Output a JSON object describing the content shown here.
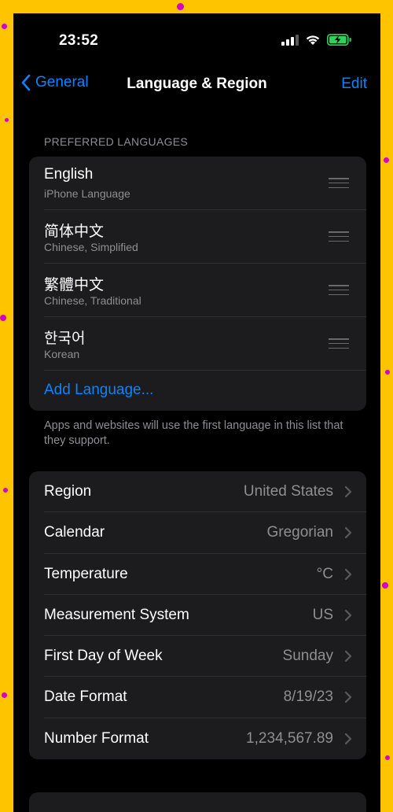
{
  "status": {
    "time": "23:52"
  },
  "nav": {
    "back_label": "General",
    "title": "Language & Region",
    "edit_label": "Edit"
  },
  "preferred": {
    "header": "PREFERRED LANGUAGES",
    "languages": [
      {
        "name": "English",
        "sub": "iPhone Language"
      },
      {
        "name": "简体中文",
        "sub": "Chinese, Simplified"
      },
      {
        "name": "繁體中文",
        "sub": "Chinese, Traditional"
      },
      {
        "name": "한국어",
        "sub": "Korean"
      }
    ],
    "add_label": "Add Language...",
    "footnote": "Apps and websites will use the first language in this list that they support."
  },
  "region_settings": [
    {
      "label": "Region",
      "value": "United States"
    },
    {
      "label": "Calendar",
      "value": "Gregorian"
    },
    {
      "label": "Temperature",
      "value": "°C"
    },
    {
      "label": "Measurement System",
      "value": "US"
    },
    {
      "label": "First Day of Week",
      "value": "Sunday"
    },
    {
      "label": "Date Format",
      "value": "8/19/23"
    },
    {
      "label": "Number Format",
      "value": "1,234,567.89"
    }
  ],
  "colors": {
    "accent": "#0a84ff",
    "background": "#000000",
    "cell": "#1c1c1e",
    "secondary_text": "#8e8e93",
    "frame": "#ffc400",
    "battery": "#30d158"
  }
}
